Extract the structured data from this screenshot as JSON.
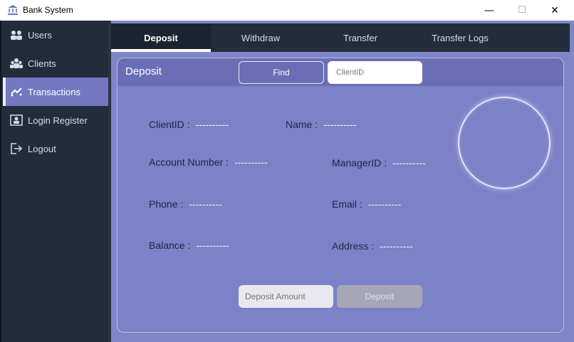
{
  "window": {
    "title": "Bank System",
    "min_glyph": "—",
    "max_glyph": "☐",
    "close_glyph": "✕"
  },
  "sidebar": {
    "items": [
      {
        "label": "Users",
        "icon": "users-icon"
      },
      {
        "label": "Clients",
        "icon": "clients-icon"
      },
      {
        "label": "Transactions",
        "icon": "transactions-icon",
        "active": true
      },
      {
        "label": "Login Register",
        "icon": "login-register-icon"
      },
      {
        "label": "Logout",
        "icon": "logout-icon"
      }
    ]
  },
  "tabs": [
    {
      "label": "Deposit",
      "active": true
    },
    {
      "label": "Withdraw"
    },
    {
      "label": "Transfer"
    },
    {
      "label": "Transfer Logs"
    }
  ],
  "card": {
    "title": "Deposit",
    "find_label": "Find",
    "client_id_placeholder": "ClientID",
    "fields": {
      "client_id": {
        "label": "ClientID :",
        "value": "----------"
      },
      "name": {
        "label": "Name :",
        "value": "----------"
      },
      "account_number": {
        "label": "Account Number :",
        "value": "----------"
      },
      "manager_id": {
        "label": "ManagerID :",
        "value": "----------"
      },
      "phone": {
        "label": "Phone :",
        "value": "----------"
      },
      "email": {
        "label": "Email :",
        "value": "----------"
      },
      "balance": {
        "label": "Balance :",
        "value": "----------"
      },
      "address": {
        "label": "Address :",
        "value": "----------"
      }
    },
    "amount_placeholder": "Deposit Amount",
    "deposit_label": "Deposit"
  },
  "colors": {
    "sidebar_bg": "#232c3b",
    "active_nav": "#7279c1",
    "main_bg": "#7f86c8",
    "card_header": "#6a6fb5"
  }
}
